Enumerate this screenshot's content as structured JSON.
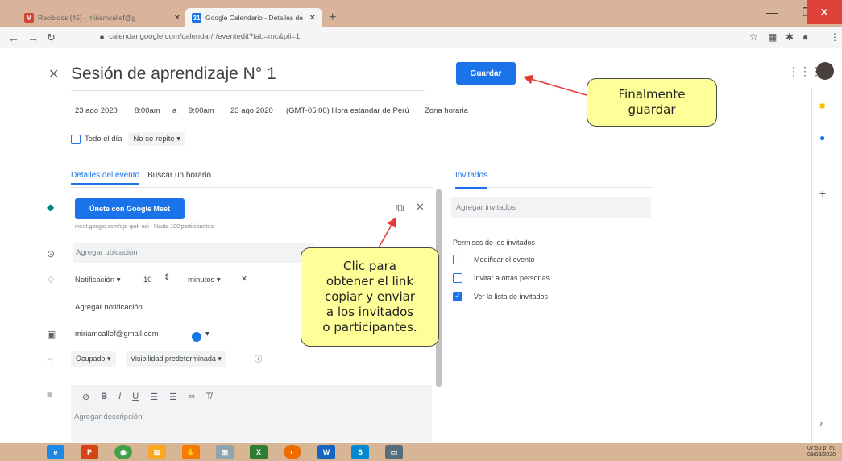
{
  "browser": {
    "tabs": [
      {
        "label": "Recibidos (45) - miriamcallef@g",
        "favicon": "gmail-icon"
      },
      {
        "label": "Google Calendario - Detalles de",
        "favicon": "calendar-icon"
      }
    ],
    "url": "calendar.google.com/calendar/r/eventedit?tab=mc&pli=1"
  },
  "event": {
    "title": "Sesión de aprendizaje N° 1",
    "save_label": "Guardar",
    "start_date": "23 ago 2020",
    "start_time": "8:00am",
    "to": "a",
    "end_time": "9:00am",
    "end_date": "23 ago 2020",
    "timezone": "(GMT-05:00) Hora estándar de Perú",
    "timezone_link": "Zona horaria",
    "all_day": "Todo el día",
    "repeat": "No se repite",
    "tab_details": "Detalles del evento",
    "tab_find_time": "Buscar un horario"
  },
  "meet": {
    "button": "Únete con Google Meet",
    "link": "meet.google.com/ejd-qiok-oai · Hasta 100 participantes"
  },
  "location": {
    "placeholder": "Agregar ubicación"
  },
  "notification": {
    "type": "Notificación",
    "value": "10",
    "unit": "minutos",
    "add": "Agregar notificación"
  },
  "calendar": {
    "owner": "miriamcallef@gmail.com",
    "color": "#1a73e8"
  },
  "status": {
    "busy": "Ocupado",
    "visibility": "Visibilidad predeterminada"
  },
  "description": {
    "placeholder": "Agregar descripción"
  },
  "guests": {
    "tab": "Invitados",
    "placeholder": "Agregar invitados",
    "permissions_title": "Permisos de los invitados",
    "permissions": [
      {
        "label": "Modificar el evento",
        "checked": false
      },
      {
        "label": "Invitar a otras personas",
        "checked": false
      },
      {
        "label": "Ver la lista de invitados",
        "checked": true
      }
    ]
  },
  "callouts": {
    "save_line1": "Finalmente",
    "save_line2": "guardar",
    "copy_line1": "Clic para",
    "copy_line2": "obtener el link",
    "copy_line3": "copiar y enviar",
    "copy_line4": "a los invitados",
    "copy_line5": "o participantes."
  },
  "taskbar": {
    "time": "07:50 p. m.",
    "date": "09/08/2020"
  }
}
